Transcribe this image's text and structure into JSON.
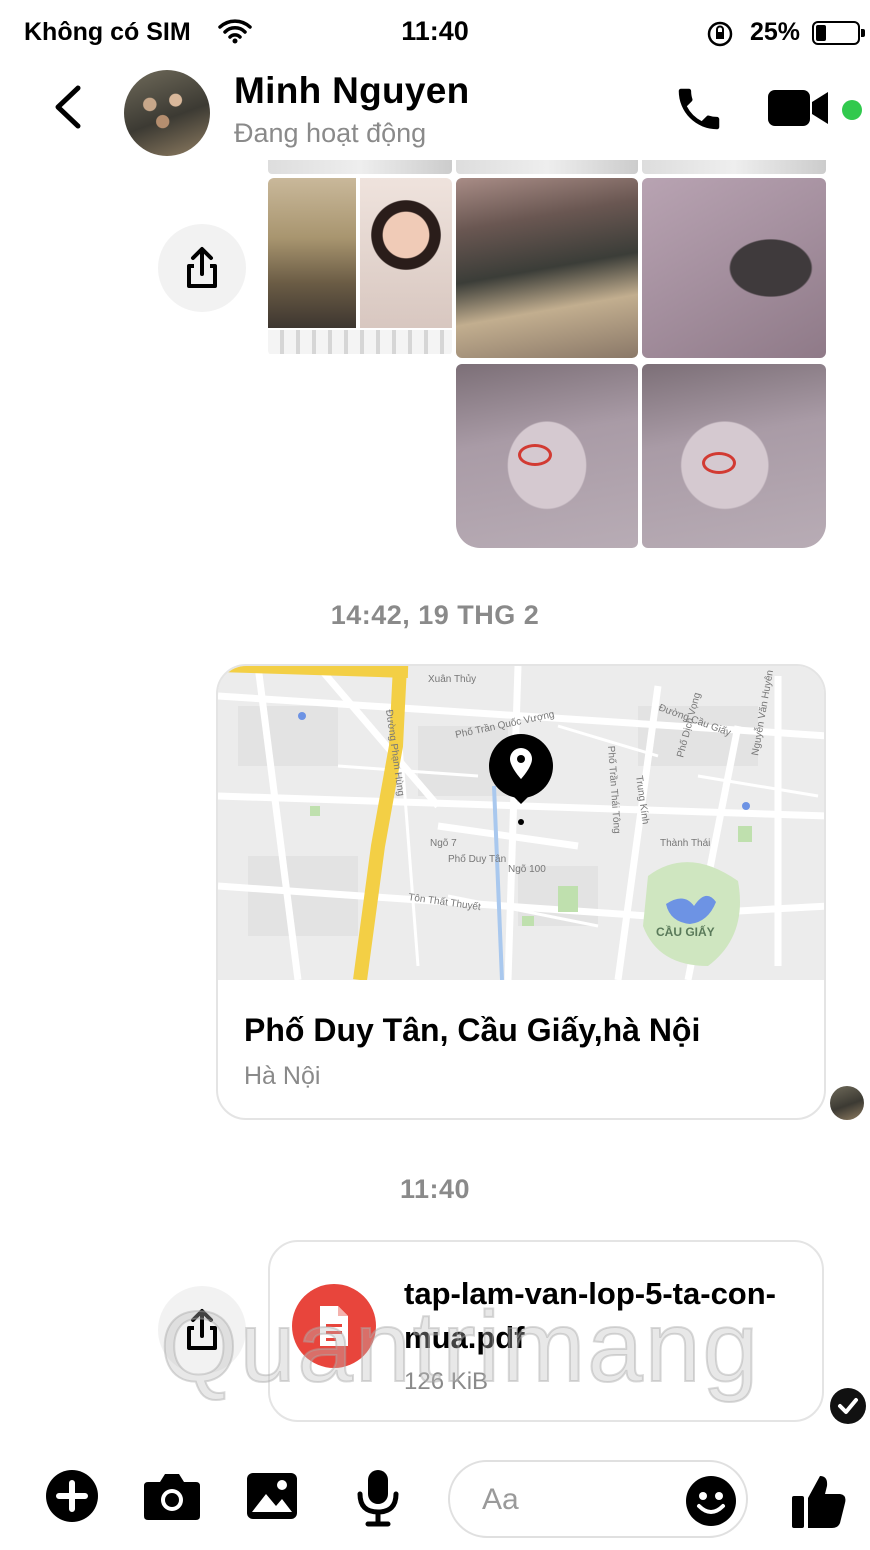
{
  "status_bar": {
    "carrier": "Không có SIM",
    "time": "11:40",
    "battery_percent": "25%",
    "battery_level": 0.25,
    "icons": [
      "wifi-icon",
      "orientation-lock-icon",
      "battery-icon"
    ]
  },
  "header": {
    "contact_name": "Minh Nguyen",
    "contact_status": "Đang hoạt động",
    "online": true,
    "accent_online": "#31c94d",
    "icons": [
      "back-chevron-icon",
      "phone-icon",
      "video-camera-icon"
    ]
  },
  "messages": {
    "timestamp_1": "14:42, 19 THG 2",
    "location": {
      "title": "Phố Duy Tân, Cầu Giấy,hà Nội",
      "subtitle": "Hà Nội",
      "map_labels": {
        "district": "CẦU GIẤY",
        "street_1": "Xuân Thủy",
        "street_2": "Đường Cầu Giấy",
        "street_3": "Phố Trần Quốc Vượng",
        "street_4": "Tôn Thất Thuyết",
        "street_5": "Phố Duy Tân",
        "street_6": "Ngõ 7",
        "street_7": "Ngõ 100",
        "street_8": "Thành Thái",
        "street_9": "Đường Phạm Hùng",
        "street_10": "Phố Trần Thái Tông",
        "street_11": "Phố Dịch Vọng",
        "street_12": "Trung Kính",
        "street_13": "Nguyễn Văn Huyên"
      }
    },
    "timestamp_2": "11:40",
    "file": {
      "name": "tap-lam-van-lop-5-ta-con-mua.pdf",
      "size": "126 KiB",
      "icon_color": "#e8453c"
    }
  },
  "watermark": "Quantrimang",
  "composer": {
    "placeholder": "Aa",
    "icons": [
      "plus-icon",
      "camera-icon",
      "image-icon",
      "microphone-icon",
      "emoji-icon",
      "thumbs-up-icon"
    ]
  }
}
